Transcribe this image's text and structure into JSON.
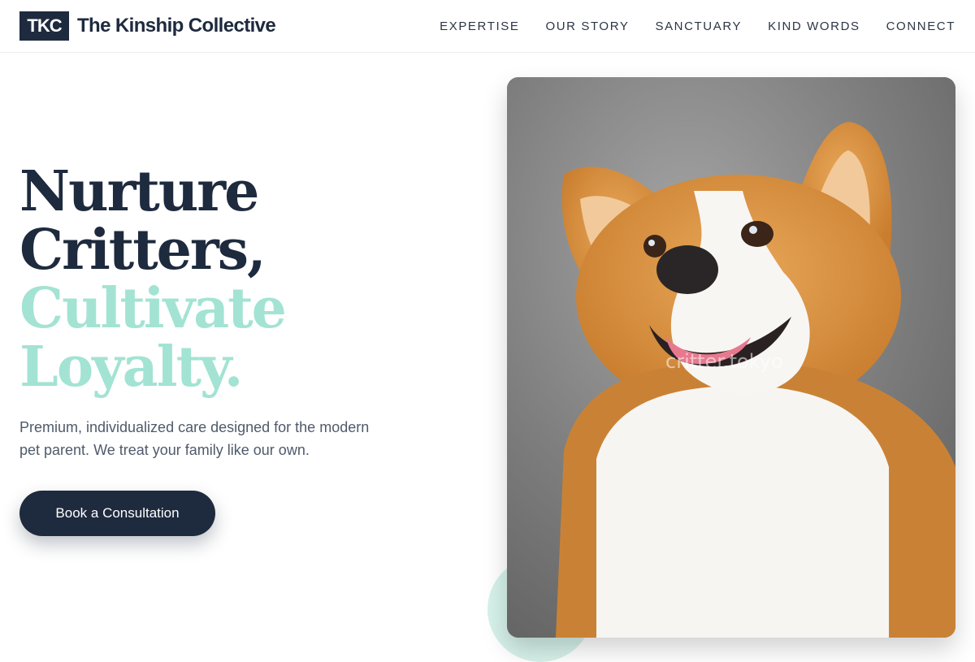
{
  "header": {
    "logo_text": "TKC",
    "brand_name": "The Kinship Collective",
    "nav": [
      {
        "label": "EXPERTISE"
      },
      {
        "label": "OUR STORY"
      },
      {
        "label": "SANCTUARY"
      },
      {
        "label": "KIND WORDS"
      },
      {
        "label": "CONNECT"
      }
    ]
  },
  "hero": {
    "headline_line1": "Nurture",
    "headline_line2": "Critters,",
    "headline_line3": "Cultivate",
    "headline_line4": "Loyalty.",
    "subtext": "Premium, individualized care designed for the modern pet parent. We treat your family like our own.",
    "cta_label": "Book a Consultation",
    "photo_watermark": "critter.tokyo"
  },
  "colors": {
    "navy": "#1e2a3e",
    "mint": "#a3e3d3",
    "muted_text": "#4f5a6b"
  }
}
